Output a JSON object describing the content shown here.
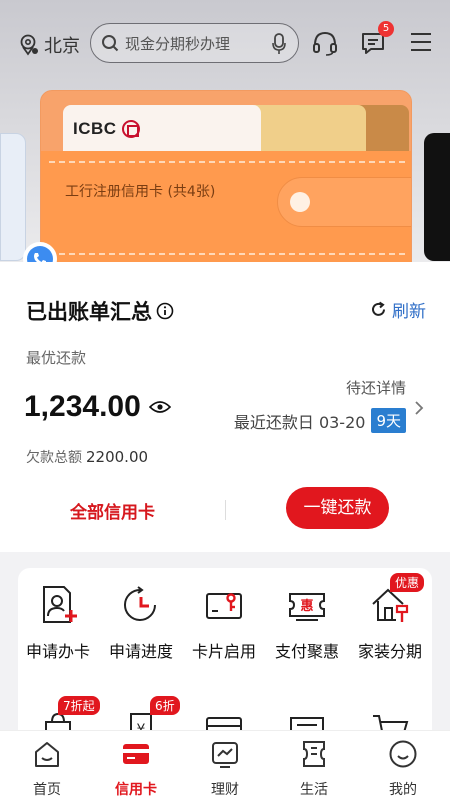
{
  "header": {
    "city": "北京",
    "search_placeholder": "现金分期秒办理",
    "message_badge": "5"
  },
  "banner": {
    "bank_logo_text": "ICBC",
    "wallet_text": "工行注册信用卡 (共4张)"
  },
  "bill": {
    "title": "已出账单汇总",
    "refresh_label": "刷新",
    "optimal_label": "最优还款",
    "amount": "1,234.00",
    "pending_label": "待还详情",
    "recent_label": "最近还款日 03-20",
    "days_badge": "9天",
    "debt_label": "欠款总额",
    "debt_value": "2200.00",
    "all_cards_label": "全部信用卡",
    "repay_button": "一键还款"
  },
  "services": [
    {
      "label": "申请办卡",
      "icon": "apply-card-icon"
    },
    {
      "label": "申请进度",
      "icon": "progress-clock-icon"
    },
    {
      "label": "卡片启用",
      "icon": "card-activate-icon"
    },
    {
      "label": "支付聚惠",
      "icon": "payment-coupon-icon"
    },
    {
      "label": "家装分期",
      "icon": "home-install-icon",
      "tag": "优惠"
    }
  ],
  "services_row2_tags": [
    "7折起",
    "6折"
  ],
  "tabbar": [
    {
      "label": "首页",
      "icon": "home-icon"
    },
    {
      "label": "信用卡",
      "icon": "credit-card-icon",
      "active": true
    },
    {
      "label": "理财",
      "icon": "chart-icon"
    },
    {
      "label": "生活",
      "icon": "ticket-icon"
    },
    {
      "label": "我的",
      "icon": "profile-icon"
    }
  ],
  "colors": {
    "accent": "#e1171e",
    "link": "#2f6ec7",
    "wallet": "#ff9a4e"
  }
}
